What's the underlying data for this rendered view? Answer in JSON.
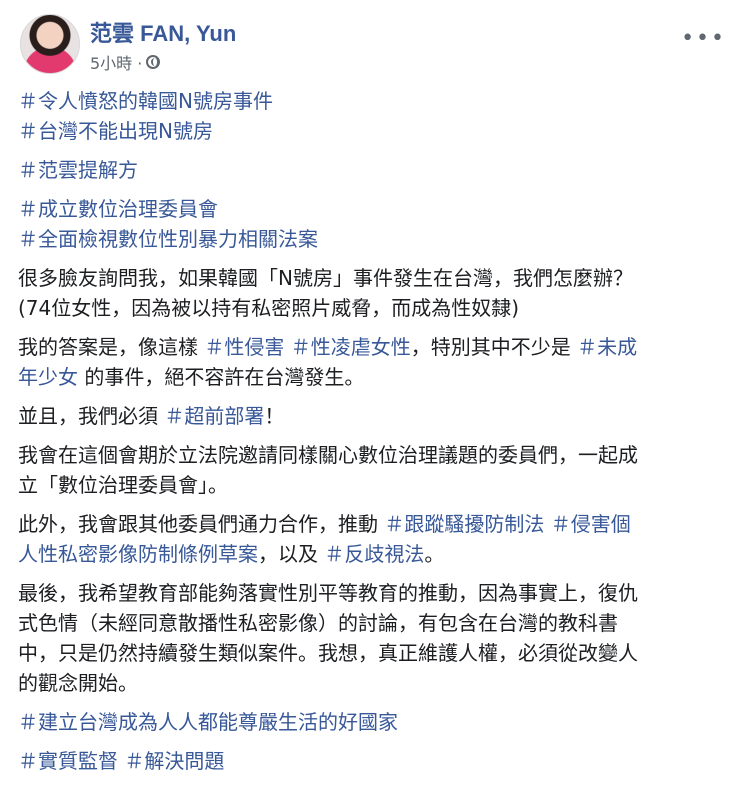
{
  "author": {
    "name": "范雲 FAN, Yun"
  },
  "post_meta": {
    "time": "5小時 ·"
  },
  "icons": {
    "more": "more-options-icon",
    "audience": "globe-icon"
  },
  "colors": {
    "hashtag": "#385898",
    "name": "#385898",
    "text": "#1c1e21",
    "meta": "#606770"
  },
  "content": {
    "p1": [
      [
        {
          "text": "＃令人憤怒的韓國N號房事件",
          "tag": true
        }
      ],
      [
        {
          "text": "＃台灣不能出現N號房",
          "tag": true
        }
      ]
    ],
    "p2": [
      [
        {
          "text": "＃范雲提解方",
          "tag": true
        }
      ]
    ],
    "p3": [
      [
        {
          "text": "＃成立數位治理委員會",
          "tag": true
        }
      ],
      [
        {
          "text": "＃全面檢視數位性別暴力相關法案",
          "tag": true
        }
      ]
    ],
    "p4": [
      [
        {
          "text": "很多臉友詢問我，如果韓國「N號房」事件發生在台灣，我們怎麼辦？",
          "tag": false
        }
      ],
      [
        {
          "text": "(74位女性，因為被以持有私密照片威脅，而成為性奴隸)",
          "tag": false
        }
      ]
    ],
    "p5": [
      [
        {
          "text": "我的答案是，像這樣 ",
          "tag": false
        },
        {
          "text": "＃性侵害",
          "tag": true
        },
        {
          "text": " ",
          "tag": false
        },
        {
          "text": "＃性凌虐女性",
          "tag": true
        },
        {
          "text": "，特別其中不少是 ",
          "tag": false
        },
        {
          "text": "＃未成",
          "tag": true
        }
      ],
      [
        {
          "text": "年少女",
          "tag": true
        },
        {
          "text": " 的事件，絕不容許在台灣發生。",
          "tag": false
        }
      ]
    ],
    "p6": [
      [
        {
          "text": "並且，我們必須 ",
          "tag": false
        },
        {
          "text": "＃超前部署",
          "tag": true
        },
        {
          "text": "！",
          "tag": false
        }
      ]
    ],
    "p7": [
      [
        {
          "text": "我會在這個會期於立法院邀請同樣關心數位治理議題的委員們，一起成",
          "tag": false
        }
      ],
      [
        {
          "text": "立「數位治理委員會」。",
          "tag": false
        }
      ]
    ],
    "p8": [
      [
        {
          "text": "此外，我會跟其他委員們通力合作，推動 ",
          "tag": false
        },
        {
          "text": "＃跟蹤騷擾防制法",
          "tag": true
        },
        {
          "text": " ",
          "tag": false
        },
        {
          "text": "＃侵害個",
          "tag": true
        }
      ],
      [
        {
          "text": "人性私密影像防制條例草案",
          "tag": true
        },
        {
          "text": "，以及 ",
          "tag": false
        },
        {
          "text": "＃反歧視法",
          "tag": true
        },
        {
          "text": "。",
          "tag": false
        }
      ]
    ],
    "p9": [
      [
        {
          "text": "最後，我希望教育部能夠落實性別平等教育的推動，因為事實上，復仇",
          "tag": false
        }
      ],
      [
        {
          "text": "式色情（未經同意散播性私密影像）的討論，有包含在台灣的教科書",
          "tag": false
        }
      ],
      [
        {
          "text": "中，只是仍然持續發生類似案件。我想，真正維護人權，必須從改變人",
          "tag": false
        }
      ],
      [
        {
          "text": "的觀念開始。",
          "tag": false
        }
      ]
    ],
    "p10": [
      [
        {
          "text": "＃建立台灣成為人人都能尊嚴生活的好國家",
          "tag": true
        }
      ]
    ],
    "p11": [
      [
        {
          "text": "＃實質監督",
          "tag": true
        },
        {
          "text": " ",
          "tag": false
        },
        {
          "text": "＃解決問題",
          "tag": true
        }
      ]
    ]
  }
}
